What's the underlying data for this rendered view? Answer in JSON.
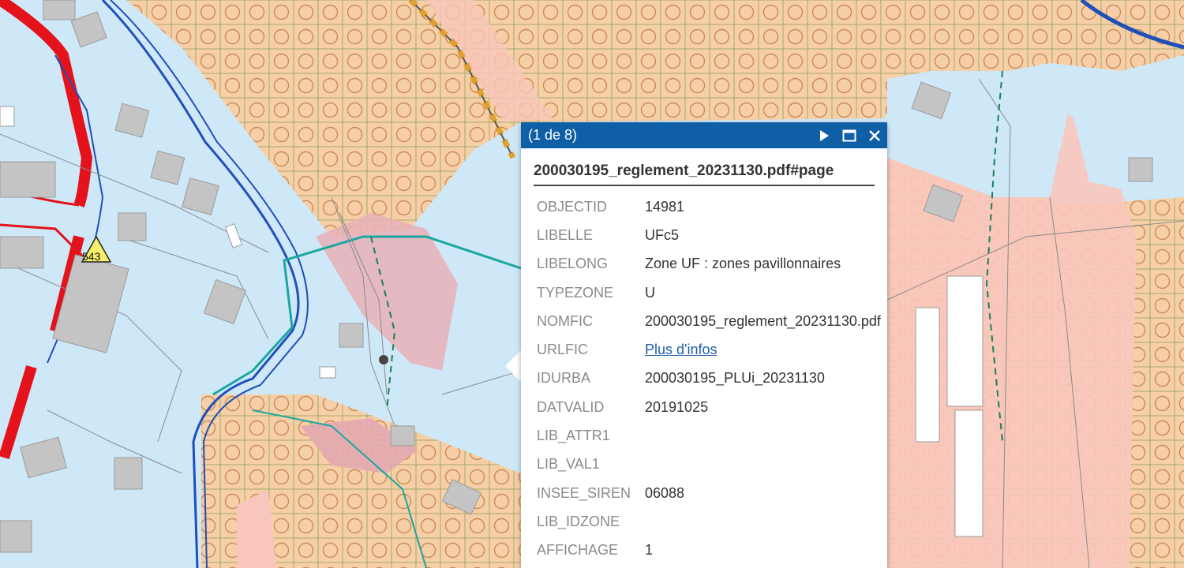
{
  "map": {
    "point_label": "543",
    "colors": {
      "water_blue": "#cfe8f8",
      "zone_orange": "#f7cfa6",
      "zone_pink": "#f8c6bc",
      "hatch_circle": "#c98a5a",
      "grid_green": "#8ea060",
      "road_red": "#e3121b",
      "river_blue": "#1f4fb8",
      "cyan_boundary": "#1aa7a0",
      "building_grey": "#c4c4c4"
    }
  },
  "popup": {
    "counter": "(1 de 8)",
    "title": "200030195_reglement_20231130.pdf#page",
    "header_bg": "#0f5fa6",
    "rows": [
      {
        "key": "OBJECTID",
        "value": "14981"
      },
      {
        "key": "LIBELLE",
        "value": "UFc5"
      },
      {
        "key": "LIBELONG",
        "value": "Zone UF : zones pavillonnaires"
      },
      {
        "key": "TYPEZONE",
        "value": "U"
      },
      {
        "key": "NOMFIC",
        "value": "200030195_reglement_20231130.pdf"
      },
      {
        "key": "URLFIC",
        "value": "Plus d'infos",
        "link": true
      },
      {
        "key": "IDURBA",
        "value": "200030195_PLUi_20231130"
      },
      {
        "key": "DATVALID",
        "value": "20191025"
      },
      {
        "key": "LIB_ATTR1",
        "value": ""
      },
      {
        "key": "LIB_VAL1",
        "value": ""
      },
      {
        "key": "INSEE_SIREN",
        "value": "06088"
      },
      {
        "key": "LIB_IDZONE",
        "value": ""
      },
      {
        "key": "AFFICHAGE",
        "value": "1"
      }
    ]
  }
}
